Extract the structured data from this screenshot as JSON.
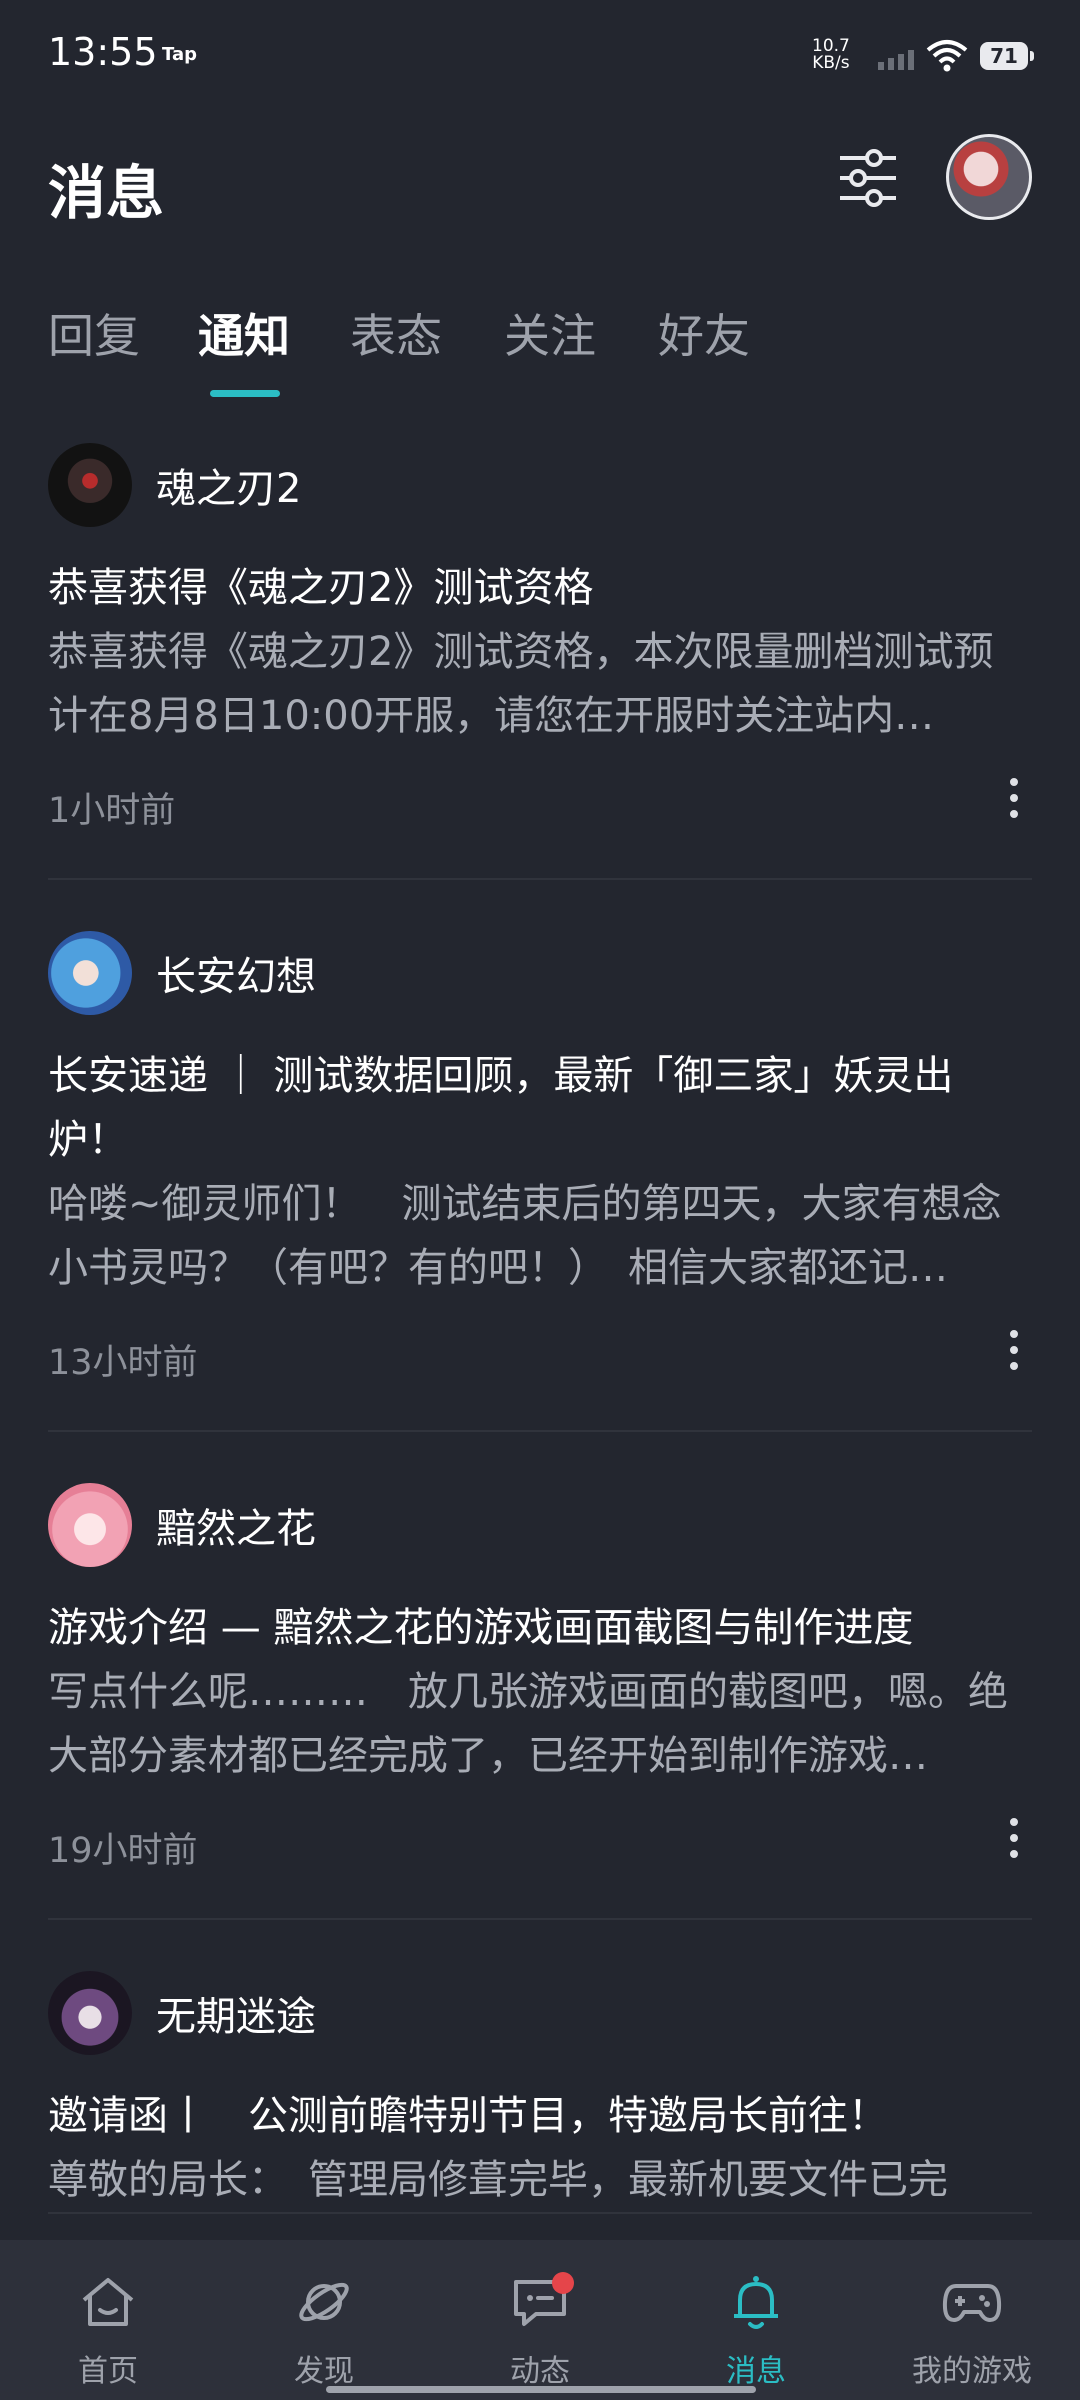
{
  "status_bar": {
    "time": "13:55",
    "app_tag": "Tap",
    "net_speed_value": "10.7",
    "net_speed_unit": "KB/s",
    "battery": "71"
  },
  "header": {
    "title": "消息"
  },
  "tabs": [
    {
      "label": "回复",
      "active": false
    },
    {
      "label": "通知",
      "active": true
    },
    {
      "label": "表态",
      "active": false
    },
    {
      "label": "关注",
      "active": false
    },
    {
      "label": "好友",
      "active": false
    }
  ],
  "notifications": [
    {
      "sender": "魂之刃2",
      "title": "恭喜获得《魂之刃2》测试资格",
      "excerpt": "恭喜获得《魂之刃2》测试资格，本次限量删档测试预计在8月8日10:00开服，请您在开服时关注站内…",
      "time": "1小时前"
    },
    {
      "sender": "长安幻想",
      "title": "长安速递 ｜ 测试数据回顾，最新「御三家」妖灵出炉！",
      "excerpt": "哈喽~御灵师们！　测试结束后的第四天，大家有想念小书灵吗？（有吧？有的吧！）　相信大家都还记…",
      "time": "13小时前"
    },
    {
      "sender": "黯然之花",
      "title": "游戏介绍 — 黯然之花的游戏画面截图与制作进度",
      "excerpt": "写点什么呢………　放几张游戏画面的截图吧，嗯。绝大部分素材都已经完成了，已经开始到制作游戏…",
      "time": "19小时前"
    },
    {
      "sender": "无期迷途",
      "title": "邀请函丨　公测前瞻特别节目，特邀局长前往！",
      "excerpt": "尊敬的局长：　管理局修葺完毕，最新机要文件已完",
      "time": ""
    }
  ],
  "bottom_nav": [
    {
      "label": "首页",
      "icon": "home-icon",
      "active": false
    },
    {
      "label": "发现",
      "icon": "planet-icon",
      "active": false
    },
    {
      "label": "动态",
      "icon": "chat-icon",
      "active": false,
      "badge": true
    },
    {
      "label": "消息",
      "icon": "bell-icon",
      "active": true
    },
    {
      "label": "我的游戏",
      "icon": "gamepad-icon",
      "active": false
    }
  ],
  "colors": {
    "background": "#23262f",
    "accent": "#2bbdc4",
    "badge": "#e5454a"
  }
}
